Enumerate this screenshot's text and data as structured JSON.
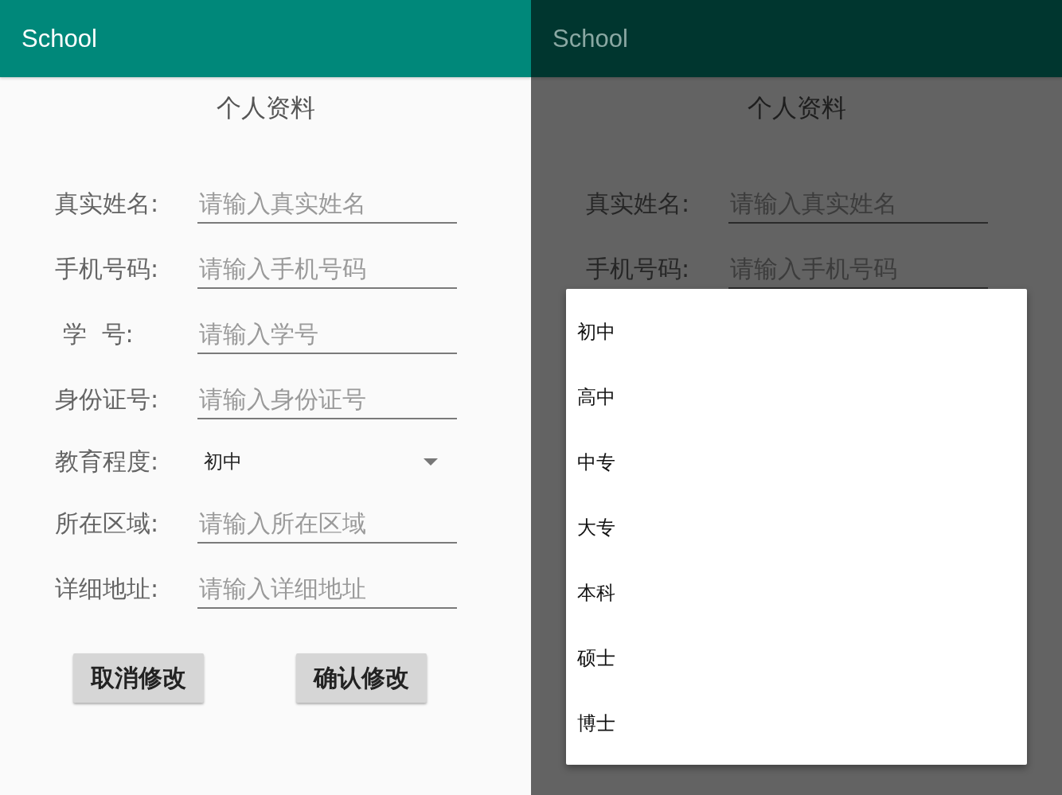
{
  "screens": [
    {
      "dimmed": false,
      "app_bar": {
        "title": "School"
      },
      "heading": "个人资料",
      "fields": [
        {
          "kind": "text",
          "label": "真实姓名:",
          "placeholder": "请输入真实姓名"
        },
        {
          "kind": "text",
          "label": "手机号码:",
          "placeholder": "请输入手机号码"
        },
        {
          "kind": "text",
          "label": " 学  号:",
          "placeholder": "请输入学号"
        },
        {
          "kind": "text",
          "label": "身份证号:",
          "placeholder": "请输入身份证号"
        },
        {
          "kind": "select",
          "label": "教育程度:",
          "value": "初中"
        },
        {
          "kind": "text",
          "label": "所在区域:",
          "placeholder": "请输入所在区域"
        },
        {
          "kind": "text",
          "label": "详细地址:",
          "placeholder": "请输入详细地址"
        }
      ],
      "buttons": [
        "取消修改",
        "确认修改"
      ]
    },
    {
      "dimmed": true,
      "app_bar": {
        "title": "School"
      },
      "heading": "个人资料",
      "fields": [
        {
          "kind": "text",
          "label": "真实姓名:",
          "placeholder": "请输入真实姓名"
        },
        {
          "kind": "text",
          "label": "手机号码:",
          "placeholder": "请输入手机号码"
        }
      ],
      "menu": {
        "options": [
          "初中",
          "高中",
          "中专",
          "大专",
          "本科",
          "硕士",
          "博士"
        ]
      }
    }
  ]
}
